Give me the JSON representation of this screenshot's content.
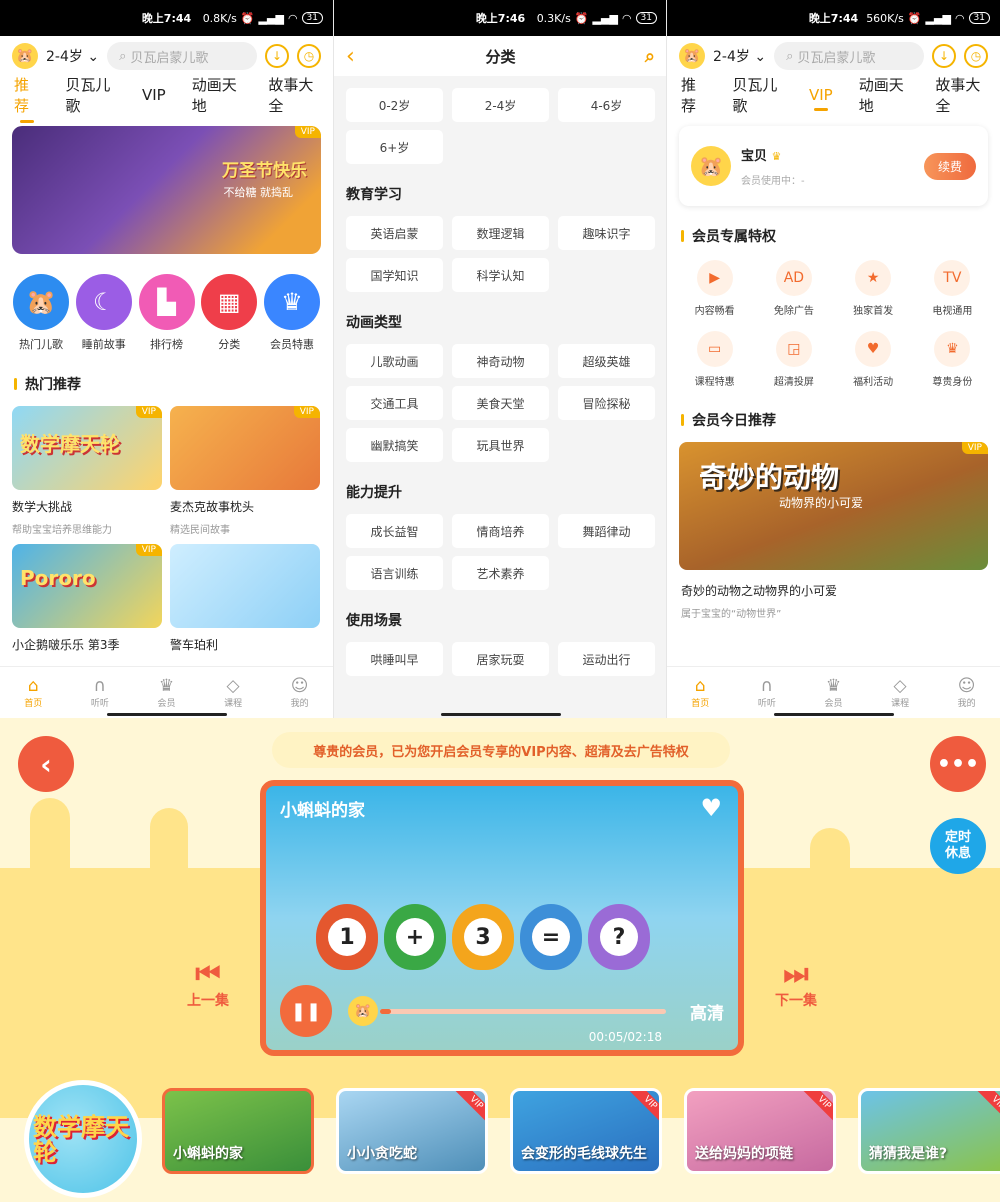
{
  "status": {
    "p1": {
      "time": "晚上7:44",
      "speed": "0.8K/s",
      "battery": "31"
    },
    "p2": {
      "time": "晚上7:46",
      "speed": "0.3K/s",
      "battery": "31"
    },
    "p3": {
      "time": "晚上7:44",
      "speed": "560K/s",
      "battery": "31"
    }
  },
  "home": {
    "age": "2-4岁",
    "search_placeholder": "贝瓦启蒙儿歌",
    "tabs": [
      "推荐",
      "贝瓦儿歌",
      "VIP",
      "动画天地",
      "故事大全"
    ],
    "banner": {
      "vip": "VIP",
      "title": "万圣节快乐",
      "subtitle": "不给糖 就捣乱"
    },
    "categories": [
      {
        "label": "热门儿歌",
        "color": "#2d8cf0",
        "icon": "beaver-icon"
      },
      {
        "label": "睡前故事",
        "color": "#9b5de5",
        "icon": "moon-icon"
      },
      {
        "label": "排行榜",
        "color": "#f15bb5",
        "icon": "podium-icon"
      },
      {
        "label": "分类",
        "color": "#ef3e4a",
        "icon": "grid-icon"
      },
      {
        "label": "会员特惠",
        "color": "#3a86ff",
        "icon": "crown-icon"
      }
    ],
    "hot_title": "热门推荐",
    "cards": [
      {
        "title": "数学大挑战",
        "sub": "帮助宝宝培养思维能力",
        "vip": "VIP",
        "img_text": "数学摩天轮",
        "c1": "#8fd8f5",
        "c2": "#ffd36b"
      },
      {
        "title": "麦杰克故事枕头",
        "sub": "精选民间故事",
        "vip": "VIP",
        "img_text": "",
        "c1": "#f6b24e",
        "c2": "#e7793a"
      },
      {
        "title": "小企鹅啵乐乐 第3季",
        "sub": "",
        "vip": "VIP",
        "img_text": "Pororo",
        "c1": "#4fb3e8",
        "c2": "#f2d55b"
      },
      {
        "title": "警车珀利",
        "sub": "",
        "vip": "",
        "img_text": "",
        "c1": "#cfeeff",
        "c2": "#8ed0f6"
      }
    ]
  },
  "nav": [
    {
      "label": "首页",
      "icon": "home-icon",
      "glyph": "⌂"
    },
    {
      "label": "听听",
      "icon": "headphones-icon",
      "glyph": "∩"
    },
    {
      "label": "会员",
      "icon": "crown-icon",
      "glyph": "♛"
    },
    {
      "label": "课程",
      "icon": "course-icon",
      "glyph": "◇"
    },
    {
      "label": "我的",
      "icon": "profile-icon",
      "glyph": "☺"
    }
  ],
  "category_page": {
    "title": "分类",
    "ages": [
      "0-2岁",
      "2-4岁",
      "4-6岁",
      "6+岁"
    ],
    "groups": [
      {
        "title": "教育学习",
        "items": [
          "英语启蒙",
          "数理逻辑",
          "趣味识字",
          "国学知识",
          "科学认知"
        ]
      },
      {
        "title": "动画类型",
        "items": [
          "儿歌动画",
          "神奇动物",
          "超级英雄",
          "交通工具",
          "美食天堂",
          "冒险探秘",
          "幽默搞笑",
          "玩具世界"
        ]
      },
      {
        "title": "能力提升",
        "items": [
          "成长益智",
          "情商培养",
          "舞蹈律动",
          "语言训练",
          "艺术素养"
        ]
      },
      {
        "title": "使用场景",
        "items": [
          "哄睡叫早",
          "居家玩耍",
          "运动出行"
        ]
      }
    ]
  },
  "vip_page": {
    "user_name": "宝贝",
    "member_status": "会员使用中：-",
    "renew": "续费",
    "priv_title": "会员专属特权",
    "privileges": [
      {
        "label": "内容畅看",
        "icon": "video-icon",
        "glyph": "▶"
      },
      {
        "label": "免除广告",
        "icon": "no-ads-icon",
        "glyph": "AD"
      },
      {
        "label": "独家首发",
        "icon": "star-icon",
        "glyph": "★"
      },
      {
        "label": "电视通用",
        "icon": "tv-icon",
        "glyph": "TV"
      },
      {
        "label": "课程特惠",
        "icon": "ticket-icon",
        "glyph": "▭"
      },
      {
        "label": "超清投屏",
        "icon": "cast-icon",
        "glyph": "◲"
      },
      {
        "label": "福利活动",
        "icon": "gift-icon",
        "glyph": "♥"
      },
      {
        "label": "尊贵身份",
        "icon": "crown-icon",
        "glyph": "♛"
      }
    ],
    "today_title": "会员今日推荐",
    "feature": {
      "vip": "VIP",
      "img_title": "奇妙的动物",
      "img_sub": "动物界的小可爱",
      "title": "奇妙的动物之动物界的小可爱",
      "sub": "属于宝宝的“动物世界”"
    }
  },
  "player": {
    "notice": "尊贵的会员，已为您开启会员专享的VIP内容、超清及去广告特权",
    "timer_label": "定时休息",
    "video_title": "小蝌蚪的家",
    "quality": "高清",
    "time": "00:05/02:18",
    "progress": 0.04,
    "prev_label": "上一集",
    "next_label": "下一集",
    "cover_text": "数学摩天轮",
    "birds": [
      {
        "sym": "1",
        "color": "#e4572e"
      },
      {
        "sym": "+",
        "color": "#3aa845"
      },
      {
        "sym": "3",
        "color": "#f4a51c"
      },
      {
        "sym": "=",
        "color": "#3d8fd8"
      },
      {
        "sym": "?",
        "color": "#9a6bd6"
      }
    ],
    "episodes": [
      {
        "title": "小蝌蚪的家",
        "vip": "",
        "c1": "#7cc24a",
        "c2": "#3a8f3a",
        "active": true
      },
      {
        "title": "小小贪吃蛇",
        "vip": "VIP",
        "c1": "#a9d6f2",
        "c2": "#4f8fb8",
        "active": false
      },
      {
        "title": "会变形的毛线球先生",
        "vip": "VIP",
        "c1": "#3fa3e0",
        "c2": "#2a6fbf",
        "active": false
      },
      {
        "title": "送给妈妈的项链",
        "vip": "VIP",
        "c1": "#f2a0c0",
        "c2": "#c76aa0",
        "active": false
      },
      {
        "title": "猜猜我是谁?",
        "vip": "VIP",
        "c1": "#6cc3e8",
        "c2": "#8bc34a",
        "active": false
      }
    ]
  }
}
